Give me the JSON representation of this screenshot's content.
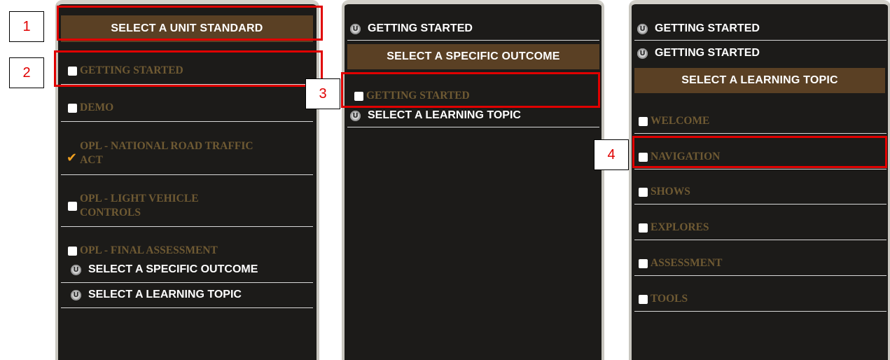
{
  "panel1": {
    "header": "SELECT A UNIT STANDARD",
    "options": [
      "GETTING STARTED",
      "DEMO",
      "OPL - NATIONAL ROAD TRAFFIC\nACT",
      "OPL - LIGHT VEHICLE\nCONTROLS",
      "OPL - FINAL ASSESSMENT"
    ],
    "nav": [
      "SELECT A SPECIFIC OUTCOME",
      "SELECT A LEARNING TOPIC"
    ]
  },
  "panel2": {
    "nav_top": "GETTING STARTED",
    "header": "SELECT A SPECIFIC OUTCOME",
    "options": [
      "GETTING STARTED"
    ],
    "nav_bottom": "SELECT A LEARNING TOPIC"
  },
  "panel3": {
    "nav_top": [
      "GETTING STARTED",
      "GETTING STARTED"
    ],
    "header": "SELECT A LEARNING TOPIC",
    "options": [
      "WELCOME",
      "NAVIGATION",
      "SHOWS",
      "EXPLORES",
      "ASSESSMENT",
      "TOOLS"
    ]
  },
  "callouts": [
    "1",
    "2",
    "3",
    "4"
  ],
  "icons": {
    "nav": "u-circle-icon",
    "checkbox": "checkbox-icon",
    "checked": "checkmark-icon"
  },
  "colors": {
    "panel_bg": "#1c1b19",
    "header_bg": "#5a4024",
    "option_text": "#6f5a33",
    "highlight": "#e00000"
  }
}
